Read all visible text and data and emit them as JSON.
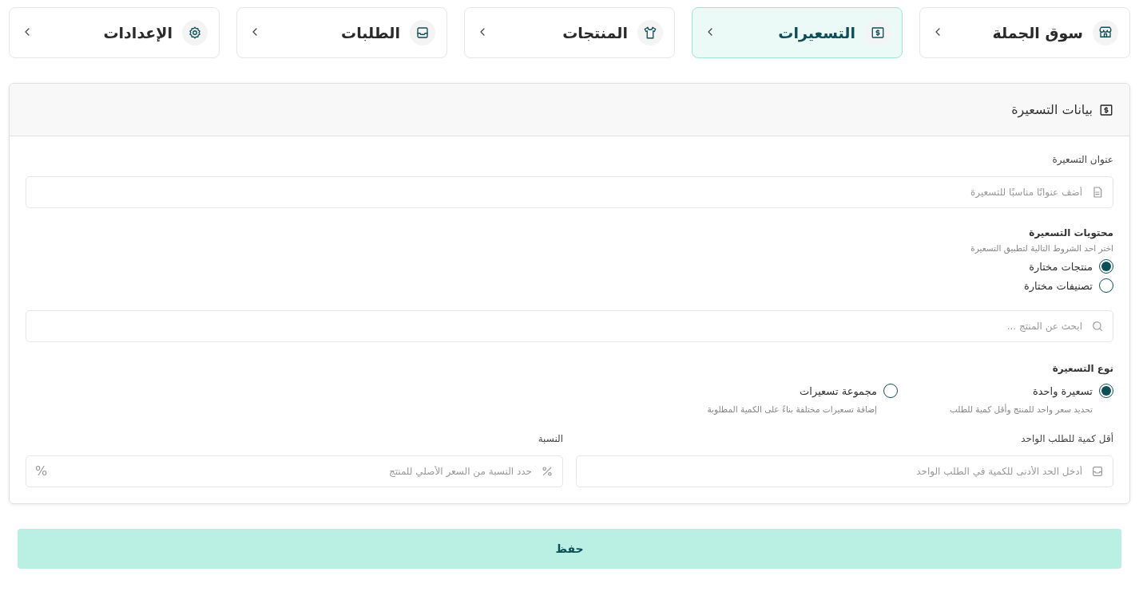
{
  "tabs": [
    {
      "label": "سوق الجملة",
      "selected": false
    },
    {
      "label": "التسعيرات",
      "selected": true
    },
    {
      "label": "المنتجات",
      "selected": false
    },
    {
      "label": "الطلبات",
      "selected": false
    },
    {
      "label": "الإعدادات",
      "selected": false
    }
  ],
  "card": {
    "title": "بيانات التسعيرة",
    "title_field": {
      "label": "عنوان التسعيرة",
      "placeholder": "أضف عنوانًا مناسبًا للتسعيرة"
    },
    "contents": {
      "label": "محتويات التسعيرة",
      "hint": "اختر احد الشروط التالية لتطبيق التسعيرة",
      "options": [
        {
          "label": "منتجات مختارة",
          "selected": true
        },
        {
          "label": "تصنيفات مختارة",
          "selected": false
        }
      ]
    },
    "search": {
      "placeholder": "ابحث عن المنتج ..."
    },
    "type": {
      "label": "نوع التسعيرة",
      "options": [
        {
          "label": "تسعيرة واحدة",
          "description": "تحديد سعر واحد للمنتج وأقل كمية للطلب",
          "selected": true
        },
        {
          "label": "مجموعة تسعيرات",
          "description": "إضافة تسعيرات مختلفة بناءً على الكمية المطلوبة",
          "selected": false
        }
      ]
    },
    "min_qty": {
      "label": "أقل كمية للطلب الواحد",
      "placeholder": "أدخل الحد الأدنى للكمية في الطلب الواحد"
    },
    "ratio": {
      "label": "النسبة",
      "placeholder": "حدد النسبة من السعر الأصلي للمنتج",
      "suffix": "%"
    }
  },
  "save_button": "حفظ"
}
